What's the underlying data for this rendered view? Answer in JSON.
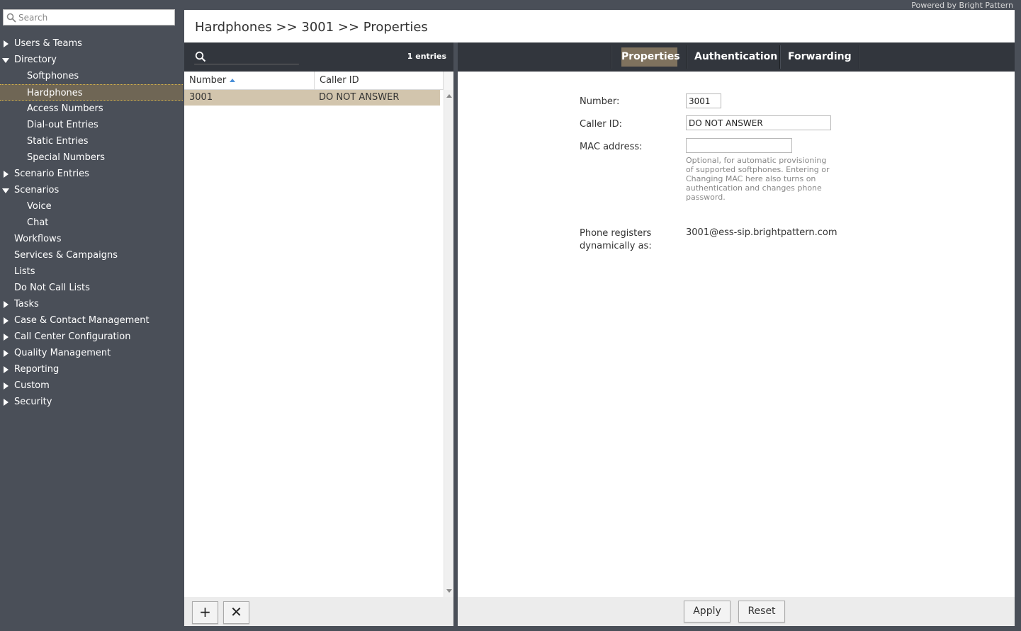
{
  "branding": {
    "powered_by": "Powered by Bright Pattern"
  },
  "sidebar": {
    "search_placeholder": "Search",
    "items": [
      {
        "label": "Users & Teams",
        "level": 0,
        "expander": "collapsed"
      },
      {
        "label": "Directory",
        "level": 0,
        "expander": "expanded"
      },
      {
        "label": "Softphones",
        "level": 1
      },
      {
        "label": "Hardphones",
        "level": 1,
        "selected": true
      },
      {
        "label": "Access Numbers",
        "level": 1
      },
      {
        "label": "Dial-out Entries",
        "level": 1
      },
      {
        "label": "Static Entries",
        "level": 1
      },
      {
        "label": "Special Numbers",
        "level": 1
      },
      {
        "label": "Scenario Entries",
        "level": 0,
        "expander": "collapsed"
      },
      {
        "label": "Scenarios",
        "level": 0,
        "expander": "expanded"
      },
      {
        "label": "Voice",
        "level": 1
      },
      {
        "label": "Chat",
        "level": 1
      },
      {
        "label": "Workflows",
        "level": 0
      },
      {
        "label": "Services & Campaigns",
        "level": 0
      },
      {
        "label": "Lists",
        "level": 0
      },
      {
        "label": "Do Not Call Lists",
        "level": 0
      },
      {
        "label": "Tasks",
        "level": 0,
        "expander": "collapsed"
      },
      {
        "label": "Case & Contact Management",
        "level": 0,
        "expander": "collapsed"
      },
      {
        "label": "Call Center Configuration",
        "level": 0,
        "expander": "collapsed"
      },
      {
        "label": "Quality Management",
        "level": 0,
        "expander": "collapsed"
      },
      {
        "label": "Reporting",
        "level": 0,
        "expander": "collapsed"
      },
      {
        "label": "Custom",
        "level": 0,
        "expander": "collapsed"
      },
      {
        "label": "Security",
        "level": 0,
        "expander": "collapsed"
      }
    ]
  },
  "header": {
    "breadcrumb": "Hardphones >> 3001 >> Properties"
  },
  "list": {
    "search_value": "",
    "entries_count": "1 entries",
    "columns": [
      "Number",
      "Caller ID"
    ],
    "sort_column": "Number",
    "rows": [
      {
        "number": "3001",
        "caller_id": "DO NOT ANSWER",
        "selected": true
      }
    ],
    "add_label": "+",
    "delete_label": "✕"
  },
  "tabs": [
    {
      "label": "Properties",
      "active": true
    },
    {
      "label": "Authentication",
      "active": false
    },
    {
      "label": "Forwarding",
      "active": false
    }
  ],
  "form": {
    "number_label": "Number:",
    "number_value": "3001",
    "caller_id_label": "Caller ID:",
    "caller_id_value": "DO NOT ANSWER",
    "mac_label": "MAC address:",
    "mac_value": "",
    "mac_hint": "Optional, for automatic provisioning of supported softphones. Entering or Changing MAC here also turns on authentication and changes phone password.",
    "registers_label_line1": "Phone registers",
    "registers_label_line2": "dynamically as:",
    "registers_value": "3001@ess-sip.brightpattern.com"
  },
  "footer": {
    "apply_label": "Apply",
    "reset_label": "Reset"
  },
  "colors": {
    "sidebar_bg": "#4a4f58",
    "toolbar_bg": "#32363d",
    "active_tab": "#7f725e",
    "selected_row": "#d2c5ad",
    "selected_nav": "#6f6655"
  }
}
